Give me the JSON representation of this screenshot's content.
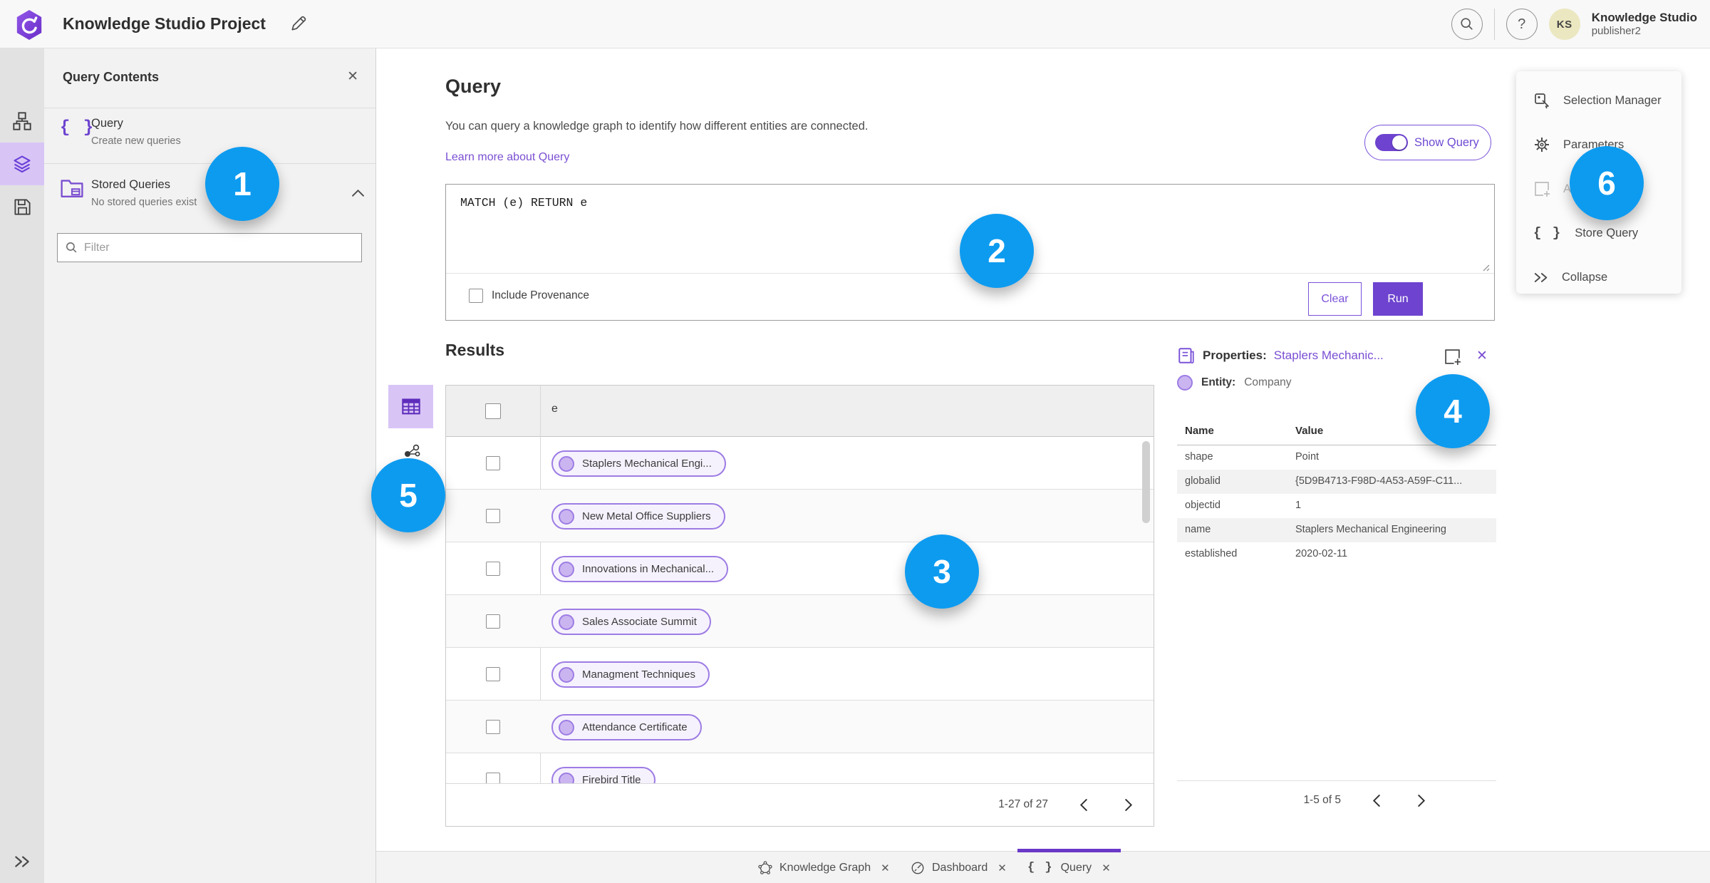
{
  "header": {
    "title": "Knowledge Studio Project",
    "user": {
      "name": "Knowledge Studio",
      "role": "publisher2",
      "initials": "KS"
    }
  },
  "contents": {
    "title": "Query Contents",
    "close": "✕",
    "query_item": {
      "label": "Query",
      "sub": "Create new queries"
    },
    "stored_item": {
      "label": "Stored Queries",
      "sub": "No stored queries exist"
    },
    "filter_placeholder": "Filter"
  },
  "query": {
    "heading": "Query",
    "description": "You can query a knowledge graph to identify how different entities are connected.",
    "learn_more": "Learn more about Query",
    "show_query": "Show Query",
    "code": "MATCH (e) RETURN e",
    "include_provenance": "Include Provenance",
    "clear": "Clear",
    "run": "Run"
  },
  "results": {
    "heading": "Results",
    "column_header": "e",
    "rows": [
      "Staplers Mechanical Engi...",
      "New Metal Office Suppliers",
      "Innovations in Mechanical...",
      "Sales Associate Summit",
      "Managment Techniques",
      "Attendance Certificate",
      "Firebird Title"
    ],
    "pagination": "1-27 of 27"
  },
  "properties": {
    "label": "Properties:",
    "link": "Staplers Mechanic...",
    "close": "✕",
    "entity_label": "Entity:",
    "entity_value": "Company",
    "columns": {
      "name": "Name",
      "value": "Value"
    },
    "rows": [
      {
        "name": "shape",
        "value": "Point"
      },
      {
        "name": "globalid",
        "value": "{5D9B4713-F98D-4A53-A59F-C11..."
      },
      {
        "name": "objectid",
        "value": "1"
      },
      {
        "name": "name",
        "value": "Staplers Mechanical Engineering"
      },
      {
        "name": "established",
        "value": "2020-02-11"
      }
    ],
    "pagination": "1-5 of 5"
  },
  "context_menu": {
    "items": [
      {
        "label": "Selection Manager"
      },
      {
        "label": "Parameters"
      },
      {
        "label": "Ad",
        "disabled": true
      },
      {
        "label": "Store Query"
      },
      {
        "label": "Collapse"
      }
    ]
  },
  "tabs": [
    {
      "label": "Knowledge Graph",
      "close": "✕"
    },
    {
      "label": "Dashboard",
      "close": "✕"
    },
    {
      "label": "Query",
      "close": "✕",
      "active": true
    }
  ],
  "annotations": [
    "1",
    "2",
    "3",
    "4",
    "5",
    "6"
  ],
  "colors": {
    "accent_purple": "#6d43cf",
    "light_purple": "#d8c5f6",
    "pill_fill": "#f6f2fd",
    "pill_border": "#9d7ce4",
    "annotation_blue": "#0d9bf0",
    "link_purple": "#7a4fd3"
  }
}
